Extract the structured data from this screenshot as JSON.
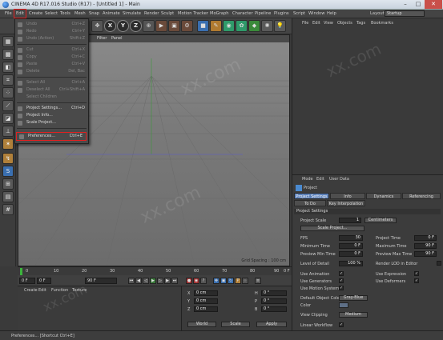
{
  "window": {
    "title": "CINEMA 4D R17.016 Studio (R17) - [Untitled 1] - Main"
  },
  "menubar": {
    "items": [
      "File",
      "Edit",
      "Create",
      "Select",
      "Tools",
      "Mesh",
      "Snap",
      "Animate",
      "Simulate",
      "Render",
      "Sculpt",
      "Motion Tracker",
      "MoGraph",
      "Character",
      "Pipeline",
      "Plugins",
      "Script",
      "Window",
      "Help"
    ],
    "layout_label": "Layout:",
    "layout_value": "Startup"
  },
  "toolbar": {
    "x_label": "X",
    "y_label": "Y",
    "z_label": "Z"
  },
  "viewport": {
    "menu": [
      "Filter",
      "Panel"
    ],
    "label": "Perspective",
    "grid_spacing": "Grid Spacing : 100 cm"
  },
  "timeline": {
    "ticks": [
      "0",
      "10",
      "20",
      "30",
      "40",
      "50",
      "60",
      "70",
      "80",
      "90"
    ],
    "end_frame": "0 F",
    "current": "0 F",
    "start": "0 F",
    "max": "90 F"
  },
  "material_manager": {
    "menu": [
      "Create",
      "Edit",
      "Function",
      "Texture"
    ]
  },
  "coord_manager": {
    "labels": [
      "X",
      "Y",
      "Z",
      "H",
      "P",
      "B"
    ],
    "values": [
      "0 cm",
      "0 cm",
      "0 cm",
      "0 °",
      "0 °",
      "0 °"
    ],
    "dropdown1": "World",
    "dropdown2": "Scale",
    "apply": "Apply"
  },
  "status": {
    "text": "Preferences... [Shortcut Ctrl+E]"
  },
  "object_manager": {
    "menu": [
      "File",
      "Edit",
      "View",
      "Objects",
      "Tags",
      "Bookmarks"
    ]
  },
  "attributes": {
    "menu": [
      "Mode",
      "Edit",
      "User Data"
    ],
    "title": "Project",
    "tabs_row1": [
      "Project Settings",
      "Info",
      "Dynamics",
      "Referencing"
    ],
    "tabs_row2": [
      "To Do",
      "Key Interpolation"
    ],
    "section": "Project Settings",
    "project_scale_label": "Project Scale",
    "project_scale_value": "1",
    "project_scale_unit": "Centimeters",
    "scale_project_btn": "Scale Project...",
    "fps_label": "FPS",
    "fps_value": "30",
    "project_time_label": "Project Time",
    "project_time_value": "0 F",
    "min_time_label": "Minimum Time",
    "min_time_value": "0 F",
    "max_time_label": "Maximum Time",
    "max_time_value": "90 F",
    "prev_min_label": "Preview Min Time",
    "prev_min_value": "0 F",
    "prev_max_label": "Preview Max Time",
    "prev_max_value": "90 F",
    "lod_label": "Level of Detail",
    "lod_value": "100 %",
    "render_lod_label": "Render LOD in Editor",
    "use_anim_label": "Use Animation",
    "use_expr_label": "Use Expression",
    "use_gen_label": "Use Generators",
    "use_deform_label": "Use Deformers",
    "use_motion_label": "Use Motion System",
    "default_color_label": "Default Object Color",
    "default_color_value": "Gray-Blue",
    "color_label": "Color",
    "view_clip_label": "View Clipping",
    "view_clip_value": "Medium",
    "linear_wf_label": "Linear Workflow"
  },
  "edit_menu": {
    "items": [
      {
        "label": "Undo",
        "shortcut": "Ctrl+Z",
        "disabled": true
      },
      {
        "label": "Redo",
        "shortcut": "Ctrl+Y",
        "disabled": true
      },
      {
        "label": "Undo (Action)",
        "shortcut": "Shift+Z",
        "disabled": true
      },
      {
        "label": "Cut",
        "shortcut": "Ctrl+X",
        "disabled": true
      },
      {
        "label": "Copy",
        "shortcut": "Ctrl+C",
        "disabled": true
      },
      {
        "label": "Paste",
        "shortcut": "Ctrl+V",
        "disabled": true
      },
      {
        "label": "Delete",
        "shortcut": "Del, Bac",
        "disabled": true
      },
      {
        "label": "Select All",
        "shortcut": "Ctrl+A",
        "disabled": true
      },
      {
        "label": "Deselect All",
        "shortcut": "Ctrl+Shift+A",
        "disabled": true
      },
      {
        "label": "Select Children",
        "shortcut": "",
        "disabled": true
      },
      {
        "label": "Project Settings...",
        "shortcut": "Ctrl+D",
        "disabled": false
      },
      {
        "label": "Project Info...",
        "shortcut": "",
        "disabled": false
      },
      {
        "label": "Scale Project...",
        "shortcut": "",
        "disabled": false
      },
      {
        "label": "Preferences...",
        "shortcut": "Ctrl+E",
        "disabled": false
      }
    ]
  },
  "watermark": "xx.com",
  "colors": {
    "accent": "#5a7fb8",
    "highlight": "#e02020"
  }
}
